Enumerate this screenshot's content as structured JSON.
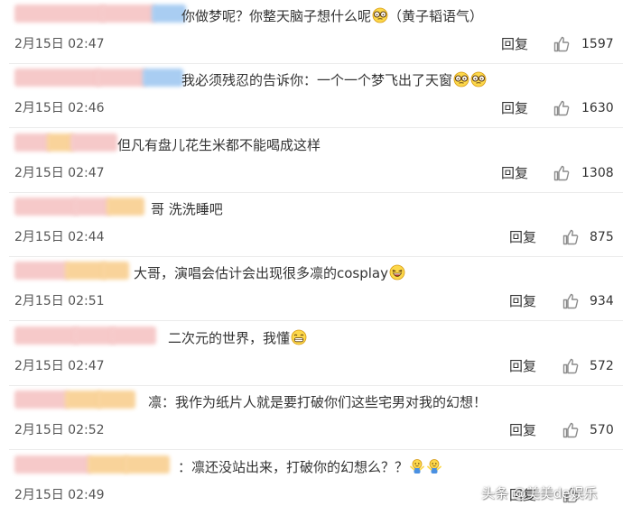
{
  "comments": [
    {
      "text": "你做梦呢？你整天脑子想什么呢",
      "emoji": [
        "glasses-face"
      ],
      "suffix": "（黄子韬语气）",
      "timestamp": "2月15日 02:47",
      "reply": "回复",
      "likes": "1597"
    },
    {
      "text": "我必须残忍的告诉你：一个一个梦飞出了天窗",
      "emoji": [
        "glasses-face",
        "glasses-face"
      ],
      "suffix": "",
      "timestamp": "2月15日 02:46",
      "reply": "回复",
      "likes": "1630"
    },
    {
      "text": "但凡有盘儿花生米都不能喝成这样",
      "emoji": [],
      "suffix": "",
      "timestamp": "2月15日 02:47",
      "reply": "回复",
      "likes": "1308"
    },
    {
      "text": "哥 洗洗睡吧",
      "emoji": [],
      "suffix": "",
      "timestamp": "2月15日 02:44",
      "reply": "回复",
      "likes": "875"
    },
    {
      "text": "大哥，演唱会估计会出现很多凛的cosplay",
      "emoji": [
        "laughing-face"
      ],
      "suffix": "",
      "timestamp": "2月15日 02:51",
      "reply": "回复",
      "likes": "934"
    },
    {
      "text": "二次元的世界，我懂",
      "emoji": [
        "grinning-face"
      ],
      "suffix": "",
      "timestamp": "2月15日 02:47",
      "reply": "回复",
      "likes": "572"
    },
    {
      "text": "凛：我作为纸片人就是要打破你们这些宅男对我的幻想！",
      "emoji": [],
      "suffix": "",
      "timestamp": "2月15日 02:52",
      "reply": "回复",
      "likes": "570"
    },
    {
      "text": "：凛还没站出来，打破你的幻想么？？",
      "emoji": [
        "shrug-figure",
        "shrug-figure"
      ],
      "suffix": "",
      "timestamp": "2月15日 02:49",
      "reply": "回复",
      "likes": ""
    }
  ],
  "watermark": "头条 @美美de娱乐",
  "colors": {
    "text": "#333333",
    "timestamp": "#555555",
    "divider": "#ebebeb",
    "icon": "#8c8c8c",
    "blur_pink": "#f6c9c9",
    "blur_blue": "#a9cdf2",
    "blur_orange": "#f9d39a"
  }
}
